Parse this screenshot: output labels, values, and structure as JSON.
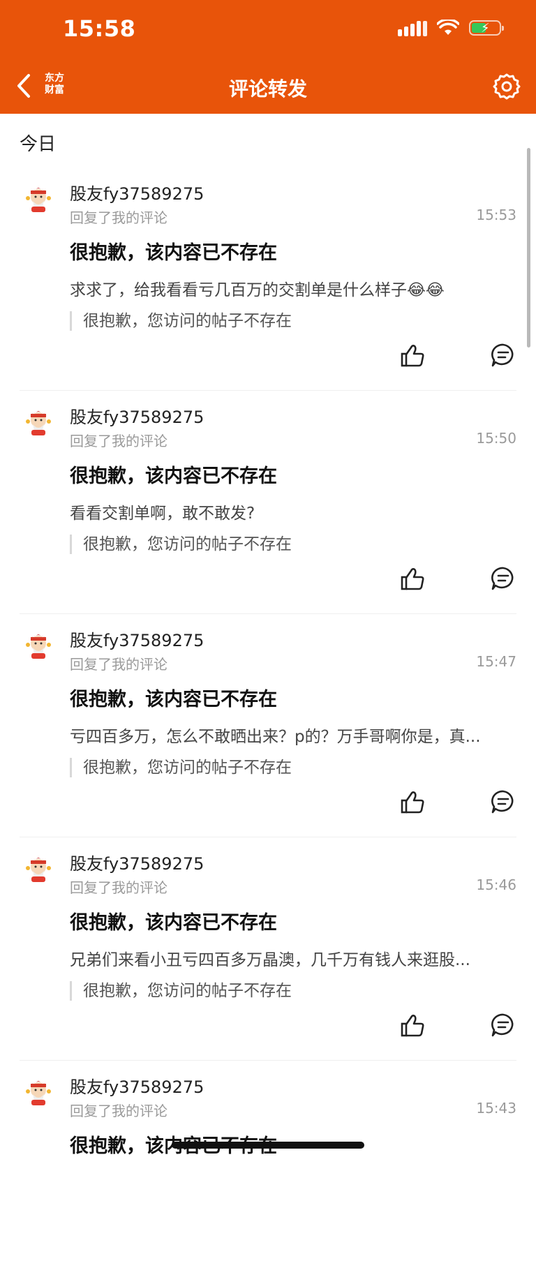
{
  "status_bar": {
    "time": "15:58"
  },
  "nav": {
    "back_icon": "chevron-left-icon",
    "logo_line1": "东方",
    "logo_line2": "财富",
    "title": "评论转发",
    "settings_icon": "gear-icon"
  },
  "section": {
    "title": "今日"
  },
  "colors": {
    "header": "#e8540a",
    "battery": "#35c759"
  },
  "items": [
    {
      "username": "股友fy37589275",
      "subtitle": "回复了我的评论",
      "time": "15:53",
      "title": "很抱歉，该内容已不存在",
      "comment": "求求了，给我看看亏几百万的交割单是什么样子😂😂",
      "quote": "很抱歉，您访问的帖子不存在"
    },
    {
      "username": "股友fy37589275",
      "subtitle": "回复了我的评论",
      "time": "15:50",
      "title": "很抱歉，该内容已不存在",
      "comment": "看看交割单啊，敢不敢发?",
      "quote": "很抱歉，您访问的帖子不存在"
    },
    {
      "username": "股友fy37589275",
      "subtitle": "回复了我的评论",
      "time": "15:47",
      "title": "很抱歉，该内容已不存在",
      "comment": "亏四百多万，怎么不敢晒出来？p的？万手哥啊你是，真...",
      "quote": "很抱歉，您访问的帖子不存在"
    },
    {
      "username": "股友fy37589275",
      "subtitle": "回复了我的评论",
      "time": "15:46",
      "title": "很抱歉，该内容已不存在",
      "comment": "兄弟们来看小丑亏四百多万晶澳，几千万有钱人来逛股...",
      "quote": "很抱歉，您访问的帖子不存在"
    },
    {
      "username": "股友fy37589275",
      "subtitle": "回复了我的评论",
      "time": "15:43",
      "title": "很抱歉，该内容已不存在",
      "comment": "",
      "quote": ""
    }
  ]
}
